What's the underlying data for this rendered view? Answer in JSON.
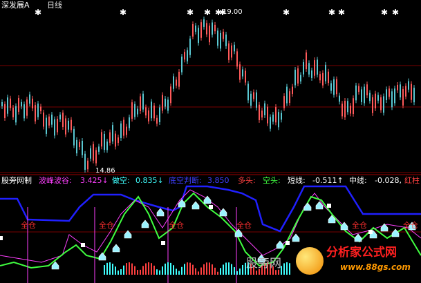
{
  "title_bar": {
    "stock_name": "深发展A",
    "period": "日线"
  },
  "main_chart": {
    "price_high_label": "19.00",
    "price_low_label": "14.86",
    "colors": {
      "up": "#ff5a5a",
      "down": "#5ac8d2",
      "grid": "#7a0000"
    }
  },
  "indicator_panel": {
    "name": "股旁网制",
    "items": [
      {
        "label": "波峰波谷:",
        "value": "3.425↓",
        "color": "#ff40ff"
      },
      {
        "label": "做空:",
        "value": "0.835↓",
        "color": "#40ffff"
      },
      {
        "label": "底空判断:",
        "value": "3.850",
        "color": "#4040ff"
      },
      {
        "label": "多头:",
        "value": "",
        "color": "#ff4040"
      },
      {
        "label": "空头:",
        "value": "",
        "color": "#40ff40"
      },
      {
        "label": "短线:",
        "value": "-0.511↑",
        "color": "#ffffff"
      },
      {
        "label": "中线:",
        "value": "-0.028,",
        "color": "#ffffff"
      },
      {
        "label": "红柱",
        "value": "",
        "color": "#ff4040"
      }
    ],
    "signal_labels": [
      "全仓",
      "全仓",
      "全仓",
      "全仓",
      "全仓",
      "全仓"
    ]
  },
  "watermark": {
    "text": "股旁网",
    "brand": "分析家公式网",
    "url": "www.88gs.com"
  }
}
